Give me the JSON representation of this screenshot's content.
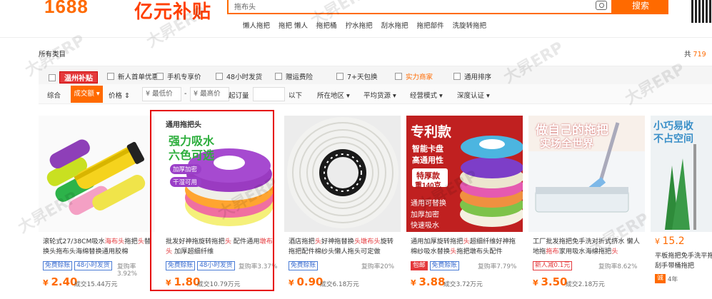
{
  "header": {
    "logo": "1688",
    "promo": "亿元补贴",
    "search_placeholder": "拖布头",
    "search_button": "搜索",
    "hot_words": [
      "懒人拖把",
      "拖把 懒人",
      "拖把桶",
      "拧水拖把",
      "刮水拖把",
      "拖把部件",
      "洗旋转拖把"
    ]
  },
  "bar": {
    "category": "所有类目",
    "total_prefix": "共",
    "total_value": "719"
  },
  "filters": {
    "badge": "温州补贴",
    "items": [
      "新人首单优惠",
      "手机专享价",
      "48小时发货",
      "赠运费险",
      "7+天包换",
      "实力商家",
      "通用排序"
    ]
  },
  "sort": {
    "items": [
      "综合",
      "成交额",
      "价格"
    ],
    "min_price": "¥ 最低价",
    "dash": "-",
    "max_price": "¥ 最高价",
    "order_label": "起订量",
    "order_suffix": "以下",
    "region": "所在地区",
    "platform": "平均货源",
    "mode": "经营模式",
    "auth": "深度认证"
  },
  "products": [
    {
      "title_a": "滚轮式27/38CM吸水",
      "title_em": "海布头",
      "title_b": "拖把",
      "title_em2": "头",
      "title_c": "替换头拖布头海绵替换通用胶棉",
      "tags": [
        "免费赊账",
        "48小时发货"
      ],
      "rate": "复购率3.92%",
      "price": "2.40",
      "sold": "成交15.44万元"
    },
    {
      "title_a": "批发好神拖旋转拖把",
      "title_em": "头",
      "title_b": " 配件通用",
      "title_em2": "墩布头",
      "title_c": " 加厚超细纤维",
      "tags": [
        "免费赊账",
        "48小时发货"
      ],
      "rate": "复购率3.37%",
      "price": "1.80",
      "sold": "成交10.79万元"
    },
    {
      "title_a": "酒店拖把",
      "title_em": "头",
      "title_b": "好神拖替换",
      "title_em2": "头墩布头",
      "title_c": "旋转拖把配件棉纱头懒人拖头可定做",
      "tags": [
        "免费赊账"
      ],
      "rate": "复购率20%",
      "price": "0.90",
      "sold": "成交6.18万元"
    },
    {
      "title_a": "通用加厚旋转拖把",
      "title_em": "头",
      "title_b": "超细纤维好神拖棉纱吸水替换",
      "title_em2": "头",
      "title_c": "拖把墩布头配件",
      "tags": [
        "包邮",
        "免费赊账"
      ],
      "rate": "复购率7.79%",
      "price": "3.88",
      "sold": "成交3.72万元"
    },
    {
      "title_a": "工厂批发拖把免手洗对折式挤水 懒人地拖",
      "title_em": "拖布",
      "title_b": "家用吸水海绵拖把",
      "title_em2": "头",
      "title_c": "",
      "tags": [
        "新人减0.1元"
      ],
      "rate": "复购率8.62%",
      "price": "3.50",
      "sold": "成交2.18万元"
    },
    {
      "title_a": "平板拖把免手洗平拖刮手带桶拖把",
      "title_em": "",
      "title_b": "",
      "title_em2": "",
      "title_c": "",
      "tags": [
        "4年"
      ],
      "rate": "",
      "price": "15.2",
      "sold": ""
    }
  ],
  "images": {
    "p2_top": "通用拖把头",
    "p2_big": "强力吸水",
    "p2_big2": "六色可选",
    "p2_pill1": "加厚加密",
    "p2_pill2": "干湿可用",
    "p4_top": "专利款",
    "p4_a": "智能卡盘",
    "p4_b": "高通用性",
    "p4_c": "特厚款",
    "p4_d": "重140克",
    "p4_e": "通用可替换",
    "p4_f": "加厚加密",
    "p4_g": "快速吸水",
    "p5_top": "做自己的拖把",
    "p5_sub": "实场全世界",
    "p6_top": "小巧易收",
    "p6_sub": "不占空间"
  },
  "watermark": "大昇ERP"
}
